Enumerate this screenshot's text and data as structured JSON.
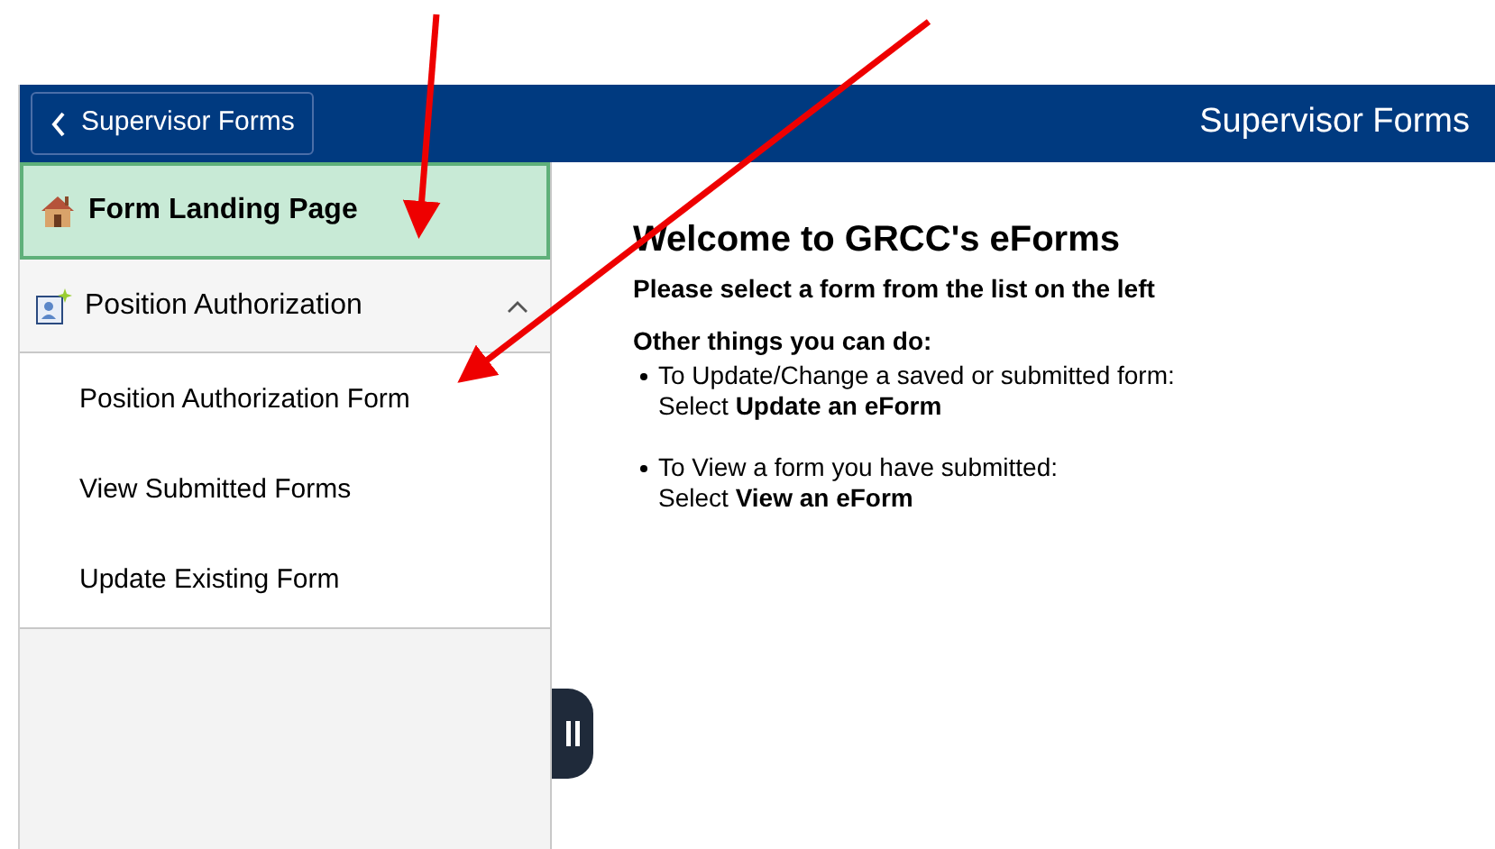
{
  "header": {
    "back_button": "Supervisor Forms",
    "title": "Supervisor Forms"
  },
  "sidebar": {
    "items": [
      {
        "kind": "home",
        "label": "Form Landing Page",
        "selected": true
      },
      {
        "kind": "group",
        "label": "Position Authorization",
        "selected": false,
        "expanded": true,
        "children": [
          {
            "label": "Position Authorization Form",
            "selected": false
          },
          {
            "label": "View Submitted Forms",
            "selected": false
          },
          {
            "label": "Update Existing Form",
            "selected": false
          }
        ]
      }
    ]
  },
  "main": {
    "heading": "Welcome to GRCC's eForms",
    "subheading": "Please select a form from the list on the left",
    "other_heading": "Other things you can do:",
    "bullets": [
      {
        "text": "To Update/Change a saved or submitted form:",
        "action": "Select **Update an eForm**"
      },
      {
        "text": "To View a form you have submitted:",
        "action": "Select **View an eForm**"
      }
    ]
  }
}
